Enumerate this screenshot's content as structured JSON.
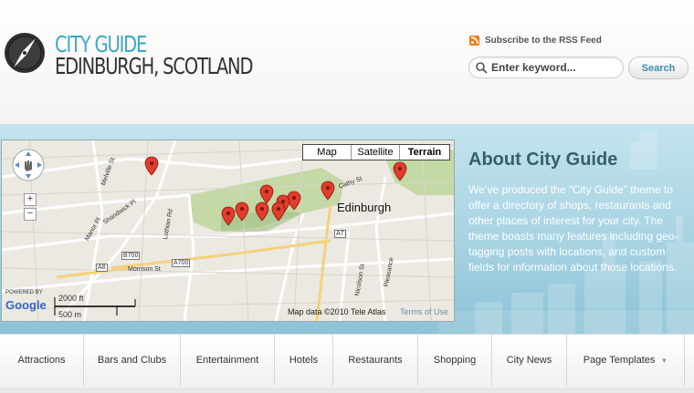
{
  "header": {
    "title_line1": "CITY GUIDE",
    "title_line2": "EDINBURGH, SCOTLAND",
    "rss_label": "Subscribe to the RSS Feed",
    "search_placeholder": "Enter keyword...",
    "search_button": "Search"
  },
  "map": {
    "type_buttons": [
      "Map",
      "Satellite",
      "Terrain"
    ],
    "selected_type": "Terrain",
    "city_label": "Edinburgh",
    "street_labels": [
      "Melville St",
      "Shandwick Pl",
      "Manor Pl",
      "Lothian Rd",
      "Morrison St",
      "B700",
      "A8",
      "A700",
      "A7",
      "Nicolson St",
      "Pleasance",
      "Cathy St"
    ],
    "powered_by": "POWERED BY",
    "google": "Google",
    "scale_ft": "2000 ft",
    "scale_m": "500 m",
    "attribution": "Map data ©2010 Tele Atlas",
    "terms": "Terms of Use",
    "zoom_in": "+",
    "zoom_out": "−"
  },
  "about": {
    "title": "About City Guide",
    "text": "We’ve produced the “City Guide” theme to offer a directory of shops, restaurants and other places of interest for your city. The theme boasts many features including geo-tagging posts with locations, and custom fields for information about those locations."
  },
  "nav": {
    "items": [
      "Attractions",
      "Bars and Clubs",
      "Entertainment",
      "Hotels",
      "Restaurants",
      "Shopping",
      "City News",
      "Page Templates"
    ]
  },
  "colors": {
    "accent": "#3fa7c4",
    "about_title": "#34606f",
    "banner": "#a8d3e3",
    "rss": "#f07a1a",
    "marker": "#e23c2c"
  },
  "icons": [
    "compass-logo-icon",
    "rss-icon",
    "magnifier-icon",
    "map-marker-icon",
    "pan-control-icon",
    "dropdown-caret-icon"
  ]
}
